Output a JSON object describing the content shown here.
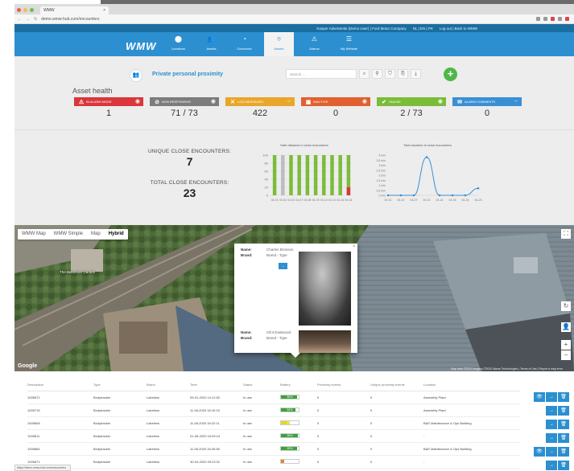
{
  "browser": {
    "tab_title": "WMW",
    "url": "demo.wmw-hub.com/encounters",
    "tab_close": "×"
  },
  "topbar": {
    "account": "Kasper Advertentie (Demo User) | Ford Motor Company",
    "languages": "NL | EN | FR",
    "links": "Log out | Back to WMW"
  },
  "nav": {
    "logo": "WMW",
    "items": [
      {
        "label": "Locations",
        "icon": "location-pin-icon",
        "glyph": "⬤"
      },
      {
        "label": "Assets",
        "icon": "users-icon",
        "glyph": "👥"
      },
      {
        "label": "Geozones",
        "icon": "geozone-icon",
        "glyph": "◔"
      },
      {
        "label": "Assets",
        "icon": "proximity-pin-icon",
        "glyph": "⌾"
      },
      {
        "label": "Alarms",
        "icon": "alarm-icon",
        "glyph": "⚠"
      },
      {
        "label": "My Website",
        "icon": "menu-icon",
        "glyph": "☰"
      }
    ]
  },
  "page": {
    "title": "Private personal proximity",
    "search_placeholder": "Search ...",
    "section_heading": "Asset health"
  },
  "cards": [
    {
      "label": "In alarm mode",
      "value": "1",
      "color": "#d9373c",
      "icon": "alarm-icon",
      "glyph": "⚠"
    },
    {
      "label": "Non responsive",
      "value": "71 / 73",
      "color": "#7c7c7c",
      "icon": "broken-link-icon",
      "glyph": "⊘"
    },
    {
      "label": "Log messages",
      "value": "422",
      "color": "#e8a72b",
      "icon": "cross-icon",
      "glyph": "✕"
    },
    {
      "label": "Inactive",
      "value": "0",
      "color": "#e0602f",
      "icon": "inactive-icon",
      "glyph": "▣"
    },
    {
      "label": "Online",
      "value": "2 / 73",
      "color": "#7bbc3a",
      "icon": "check-icon",
      "glyph": "✔"
    },
    {
      "label": "Alarm comments",
      "value": "0",
      "color": "#3a8fd3",
      "icon": "comment-icon",
      "glyph": "✉"
    }
  ],
  "encounters": {
    "unique_label": "UNIQUE CLOSE ENCOUNTERS:",
    "unique_value": "7",
    "total_label": "TOTAL CLOSE ENCOUNTERS:",
    "total_value": "23"
  },
  "chart_data": [
    {
      "type": "bar",
      "title": "Safe distance in close encounters",
      "categories": [
        "04-01",
        "04-02",
        "04-03",
        "04-07",
        "04-08",
        "04-09",
        "04-10",
        "04-14",
        "04-15",
        "04-16"
      ],
      "values": [
        100,
        100,
        100,
        100,
        100,
        100,
        100,
        100,
        100,
        100
      ],
      "bar_colors": [
        "#7bbc3a",
        "#bdbdbd",
        "#7bbc3a",
        "#7bbc3a",
        "#7bbc3a",
        "#7bbc3a",
        "#7bbc3a",
        "#7bbc3a",
        "#7bbc3a",
        "#7bbc3a"
      ],
      "red_overlay": [
        0,
        0,
        0,
        0,
        0,
        0,
        0,
        0,
        0,
        20
      ],
      "y_ticks": [
        "0",
        "20",
        "40",
        "60",
        "80",
        "100"
      ],
      "ylim": [
        0,
        100
      ]
    },
    {
      "type": "line",
      "title": "Total duration of close encounters",
      "categories": [
        "04-01",
        "04-02",
        "04-07",
        "04-10",
        "04-14",
        "04-15",
        "04-16",
        "04-23"
      ],
      "values": [
        0,
        0,
        0,
        3.8,
        0,
        0,
        0,
        0.7
      ],
      "y_ticks": [
        "0 min",
        "0.5 min",
        "1 min",
        "1.5 min",
        "2 min",
        "2.5 min",
        "3 min",
        "3.5 min",
        "4 min"
      ],
      "ylim": [
        0,
        4
      ],
      "color": "#3a8fd3"
    }
  ],
  "map": {
    "types": [
      "WMW Map",
      "WMW Simple",
      "Map",
      "Hybrid"
    ],
    "selected": "Hybrid",
    "labels": [
      "The Baltimore Garden"
    ],
    "attribution": "Map data ©2020 Imagery ©2020 Maxar Technologies | Terms of Use | Report a map error",
    "google": "Google",
    "controls": [
      "⛶",
      "↻",
      "👤",
      "+",
      "−"
    ]
  },
  "popup": {
    "name_key": "Name:",
    "brand_key": "Brand:",
    "person1_name": "Charles Bronson",
    "person1_brand": "Brand - Type",
    "person2_name": "Clint Eastwood",
    "person2_brand": "Brand - Type",
    "close": "×",
    "go": "→"
  },
  "table": {
    "columns": [
      "Description",
      "Type",
      "Brand",
      "Time",
      "Status",
      "Battery",
      "Proximity events",
      "Unique proximity events",
      "Location"
    ],
    "rows": [
      {
        "desc": "1005672",
        "type": "Bodytracker",
        "brand": "Laireless",
        "time": "09-01-2020 14:12:52",
        "status": "In use",
        "battery": "89%",
        "batt_pct": 89,
        "batt_color": "#3aa33a",
        "prox": "0",
        "unique": "0",
        "location": "Assembly Plant",
        "buttons": 3
      },
      {
        "desc": "1005715",
        "type": "Bodytracker",
        "brand": "Laireless",
        "time": "11-06-2020 16:19:19",
        "status": "In use",
        "battery": "84%",
        "batt_pct": 84,
        "batt_color": "#3aa33a",
        "prox": "0",
        "unique": "0",
        "location": "Assembly Plant",
        "buttons": 2
      },
      {
        "desc": "1005808",
        "type": "Bodytracker",
        "brand": "Laireless",
        "time": "11-06-2020 16:22:11",
        "status": "In use",
        "battery": "49%",
        "batt_pct": 49,
        "batt_color": "#e6d81a",
        "prox": "0",
        "unique": "0",
        "location": "B&E Maintenance & Ops Building",
        "buttons": 2
      },
      {
        "desc": "1005811",
        "type": "Bodytracker",
        "brand": "Laireless",
        "time": "01-06-2020 16:09:14",
        "status": "In use",
        "battery": "95%",
        "batt_pct": 95,
        "batt_color": "#3aa33a",
        "prox": "0",
        "unique": "0",
        "location": "-",
        "buttons": 2
      },
      {
        "desc": "1005864",
        "type": "Bodytracker",
        "brand": "Laireless",
        "time": "11-06-2020 16:25:56",
        "status": "In use",
        "battery": "93%",
        "batt_pct": 93,
        "batt_color": "#3aa33a",
        "prox": "0",
        "unique": "0",
        "location": "B&E Maintenance & Ops Building",
        "buttons": 3
      },
      {
        "desc": "1005871",
        "type": "Bodytracker",
        "brand": "Laireless",
        "time": "30-04-2020 09:23:31",
        "status": "In use",
        "battery": "18%",
        "batt_pct": 18,
        "batt_color": "#e08a2b",
        "prox": "0",
        "unique": "0",
        "location": "-",
        "buttons": 2
      }
    ]
  },
  "statusbar": "https://demo.wmw-hub.com/encounters"
}
